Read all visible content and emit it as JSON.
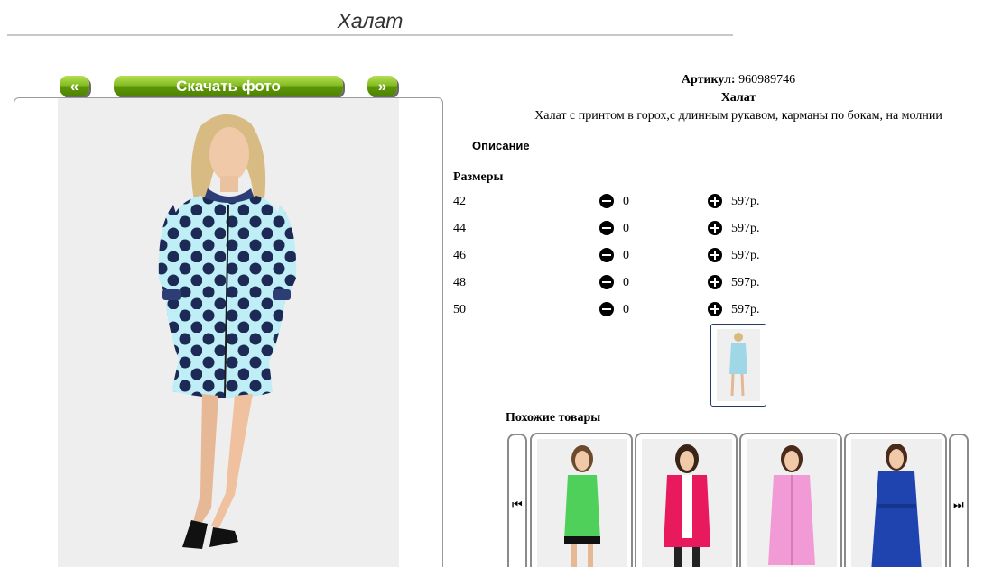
{
  "page": {
    "title": "Халат"
  },
  "gallery": {
    "prev_label": "«",
    "download_label": "Скачать фото",
    "next_label": "»"
  },
  "product": {
    "article_label": "Артикул:",
    "article_value": "960989746",
    "name": "Халат",
    "description": "Халат с принтом в горох,с длинным рукавом, карманы по бокам, на молнии",
    "description_heading": "Описание",
    "sizes_heading": "Размеры",
    "sizes": [
      {
        "size": "42",
        "qty": "0",
        "price": "597р."
      },
      {
        "size": "44",
        "qty": "0",
        "price": "597р."
      },
      {
        "size": "46",
        "qty": "0",
        "price": "597р."
      },
      {
        "size": "48",
        "qty": "0",
        "price": "597р."
      },
      {
        "size": "50",
        "qty": "0",
        "price": "597р."
      }
    ]
  },
  "similar": {
    "heading": "Похожие товары",
    "prev_icon": "⏮",
    "next_icon": "⏭",
    "items": [
      {
        "color": "#4fd05a",
        "desc": "green dress with black trim"
      },
      {
        "color": "#e8195c",
        "desc": "pink robe"
      },
      {
        "color": "#f29ad6",
        "desc": "light pink robe"
      },
      {
        "color": "#1f44b0",
        "desc": "blue robe"
      }
    ]
  },
  "colors": {
    "accent_green": "#6aa00e",
    "main_garment": "#bfeef7",
    "dots": "#1d2a55"
  }
}
